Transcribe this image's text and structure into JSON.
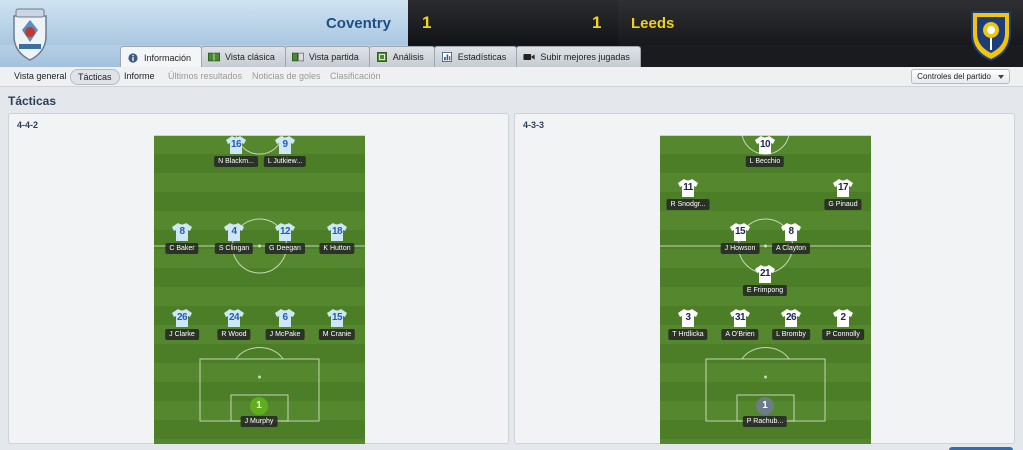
{
  "header": {
    "home_team": "Coventry",
    "away_team": "Leeds",
    "home_score": "1",
    "away_score": "1",
    "colors": {
      "home_band": "#a9c7e0",
      "score_text": "#f3d51a",
      "home_name": "#1c4f86",
      "away_name": "#f0d21a"
    }
  },
  "tabs": [
    {
      "label": "Información",
      "icon": "info-icon",
      "active": true
    },
    {
      "label": "Vista clásica",
      "icon": "pitch-icon",
      "active": false
    },
    {
      "label": "Vista partida",
      "icon": "split-pitch-icon",
      "active": false
    },
    {
      "label": "Análisis",
      "icon": "analysis-icon",
      "active": false
    },
    {
      "label": "Estadísticas",
      "icon": "stats-icon",
      "active": false
    },
    {
      "label": "Subir mejores jugadas",
      "icon": "video-camera-icon",
      "active": false
    }
  ],
  "subnav": {
    "items": [
      "Vista general",
      "Tácticas",
      "Informe",
      "Últimos resultados",
      "Noticias de goles",
      "Clasificación"
    ],
    "controls_label": "Controles del partido"
  },
  "page_title": "Tácticas",
  "home": {
    "formation": "4-4-2",
    "players": [
      {
        "num": "16",
        "name": "N Blackm..."
      },
      {
        "num": "9",
        "name": "L Jutkiew..."
      },
      {
        "num": "8",
        "name": "C Baker"
      },
      {
        "num": "4",
        "name": "S Clingan"
      },
      {
        "num": "12",
        "name": "G Deegan"
      },
      {
        "num": "18",
        "name": "K Hutton"
      },
      {
        "num": "26",
        "name": "J Clarke"
      },
      {
        "num": "24",
        "name": "R Wood"
      },
      {
        "num": "6",
        "name": "J McPake"
      },
      {
        "num": "15",
        "name": "M Cranie"
      },
      {
        "num": "1",
        "name": "J Murphy"
      }
    ]
  },
  "away": {
    "formation": "4-3-3",
    "players": [
      {
        "num": "10",
        "name": "L Becchio"
      },
      {
        "num": "11",
        "name": "R Snodgr..."
      },
      {
        "num": "17",
        "name": "G Pinaud"
      },
      {
        "num": "15",
        "name": "J Howson"
      },
      {
        "num": "8",
        "name": "A Clayton"
      },
      {
        "num": "21",
        "name": "E Frimpong"
      },
      {
        "num": "3",
        "name": "T Hrdlicka"
      },
      {
        "num": "31",
        "name": "A O'Brien"
      },
      {
        "num": "26",
        "name": "L Bromby"
      },
      {
        "num": "2",
        "name": "P Connolly"
      },
      {
        "num": "1",
        "name": "P Rachub..."
      }
    ]
  }
}
